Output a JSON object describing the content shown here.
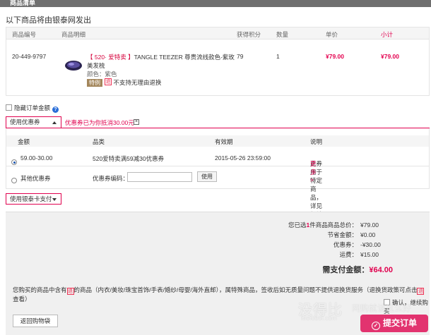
{
  "header": {
    "title": "商品清单"
  },
  "shipping_title": "以下商品将由银泰网发出",
  "table": {
    "columns": [
      "商品编号",
      "商品明细",
      "获得积分",
      "数量",
      "单价",
      "小计"
    ],
    "item": {
      "code": "20-449-9797",
      "promo": "【 520· 爱特卖 】",
      "name": "TANGLE TEEZER 尊贵流线款色-紫玫美发梳",
      "color": "颜色：紫色",
      "tag_sale": "特例",
      "tag_return_icon": "退",
      "no_return": "不支持无理由退换",
      "points": "79",
      "qty": "1",
      "unit_price": "¥79.00",
      "subtotal": "¥79.00"
    }
  },
  "hide_amount": {
    "label": "隐藏订单金额",
    "help": "?"
  },
  "coupon": {
    "toggle_label": "使用优惠券",
    "discount_msg": "优惠券已为你抵消30.00元",
    "close": "×",
    "columns": [
      "金额",
      "品类",
      "有效期",
      "说明"
    ],
    "rows": [
      {
        "amount": "59.00-30.00",
        "category": "520爱特卖满59减30优惠券",
        "expiry": "2015-05-26 23:59:00",
        "desc": "此券用于特定商品，详见促销说明",
        "more": "更多>"
      }
    ],
    "other_label": "其他优惠券",
    "code_label": "优惠券编码：",
    "code_value": "",
    "use_button": "使用"
  },
  "yintai_card": {
    "toggle_label": "使用银泰卡支付"
  },
  "summary": {
    "count_prefix": "您已选",
    "count": "1",
    "count_suffix": "件商品",
    "rows": [
      {
        "label": "商品总价：",
        "value": "¥79.00"
      },
      {
        "label": "节省金额：",
        "value": "¥0.00"
      },
      {
        "label": "优惠券：",
        "value": "-¥30.00"
      },
      {
        "label": "运费：",
        "value": "¥15.00"
      }
    ],
    "total_label": "需支付金额：",
    "total_value": "¥64.00"
  },
  "notice": {
    "part1": "您购买的商品中含有",
    "icon": "退",
    "part2": "的商品（内衣/美妆/珠宝首饰/手表/婚纱/母婴/海外直邮），属特殊商品，签收后如无质量问题不提供退换货服务（退换货政策可点击",
    "part3": "查看）"
  },
  "confirm_label": "确认，继续购买",
  "back_button": "返回购物袋",
  "submit_button": "提交订单",
  "watermark": {
    "main": "没得比",
    "sub": "网购就该这么好",
    "url": "Meidebi.com"
  },
  "colors": {
    "accent": "#e0004e",
    "submit": "#e2336f",
    "topbar": "#6f6f6f"
  }
}
